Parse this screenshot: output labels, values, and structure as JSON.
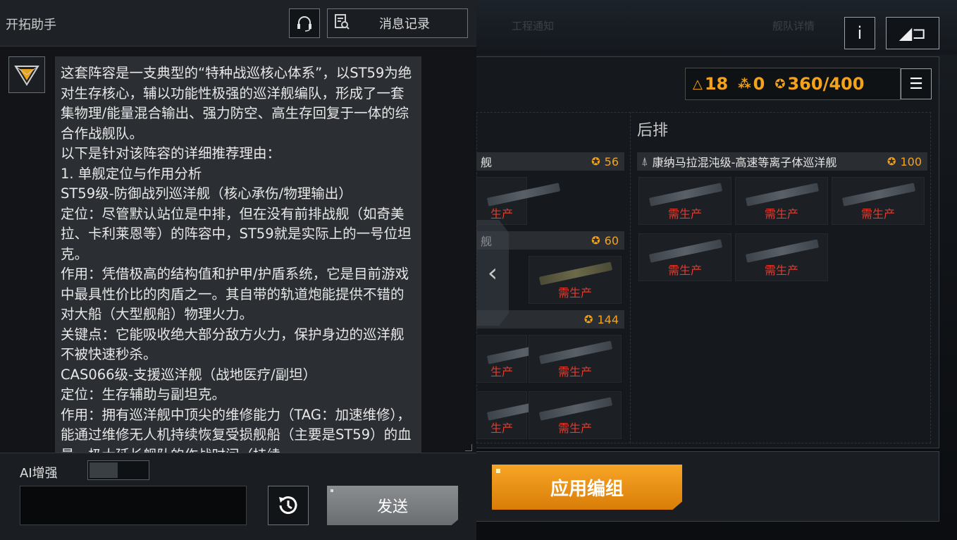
{
  "assistant": {
    "title": "开拓助手",
    "history_label": "消息记录",
    "message_paragraphs": [
      "这套阵容是一支典型的“特种战巡核心体系”，以ST59为绝对生存核心，辅以功能性极强的巡洋舰编队，形成了一套集物理/能量混合输出、强力防空、高生存回复于一体的综合作战舰队。",
      "以下是针对该阵容的详细推荐理由：",
      "1. 单舰定位与作用分析",
      "ST59级-防御战列巡洋舰（核心承伤/物理输出）",
      "定位：尽管默认站位是中排，但在没有前排战舰（如奇美拉、卡利莱恩等）的阵容中，ST59就是实际上的一号位坦克。",
      "作用：凭借极高的结构值和护甲/护盾系统，它是目前游戏中最具性价比的肉盾之一。其自带的轨道炮能提供不错的对大船（大型舰船）物理火力。",
      "关键点：它能吸收绝大部分敌方火力，保护身边的巡洋舰不被快速秒杀。",
      "CAS066级-支援巡洋舰（战地医疗/副坦）",
      "定位：生存辅助与副坦克。",
      "作用：拥有巡洋舰中顶尖的维修能力（TAG：加速维修），能通过维修无人机持续恢复受损舰船（主要是ST59）的血量，极大延长舰队的作战时间（持续"
    ],
    "ai_label": "AI增强",
    "input_placeholder": "",
    "send_label": "发送"
  },
  "topbar": {
    "ghost_text_1": "工程通知",
    "ghost_text_2": "舰队详情"
  },
  "resources": {
    "r1": "18",
    "r2": "0",
    "r3": "360/400"
  },
  "fleet": {
    "back_row_title": "后排",
    "groups": [
      {
        "name": "舰",
        "cost": "56"
      },
      {
        "name": "舰",
        "cost": "60"
      },
      {
        "name": "",
        "cost": "144"
      }
    ],
    "back_group": {
      "name": "康纳马拉混沌级-高速等离子体巡洋舰",
      "cost": "100"
    },
    "status_label": "需生产",
    "status_label_clipped": "生产"
  },
  "apply_label": "应用编组",
  "colors": {
    "accent": "#f2a21c",
    "need_produce": "#e03b2f"
  }
}
